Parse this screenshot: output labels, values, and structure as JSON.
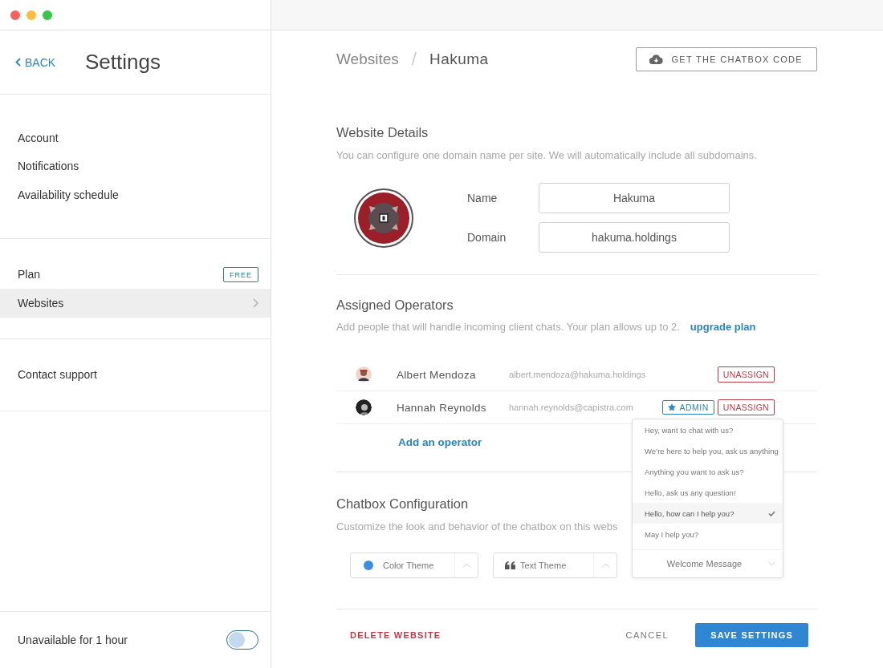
{
  "window": {
    "traffic_lights": [
      {
        "color": "#fc605c"
      },
      {
        "color": "#fdbc40"
      },
      {
        "color": "#34c84a"
      }
    ]
  },
  "sidebar": {
    "back": "BACK",
    "title": "Settings",
    "groups": [
      [
        {
          "label": "Account",
          "selected": false
        },
        {
          "label": "Notifications",
          "selected": false
        },
        {
          "label": "Availability schedule",
          "selected": false
        }
      ],
      [
        {
          "label": "Plan",
          "badge": "FREE",
          "selected": false
        },
        {
          "label": "Websites",
          "selected": true
        }
      ],
      [
        {
          "label": "Contact support",
          "selected": false
        }
      ]
    ],
    "availability": {
      "label": "Unavailable for 1 hour",
      "on": false
    }
  },
  "breadcrumb": [
    "Websites",
    "Hakuma"
  ],
  "breadcrumb_separator": "/",
  "chatbox_code_button": "GET THE CHATBOX CODE",
  "website_details": {
    "title": "Website Details",
    "description": "You can configure one domain name per site. We will automatically include all subdomains.",
    "fields": [
      {
        "label": "Name",
        "value": "Hakuma"
      },
      {
        "label": "Domain",
        "value": "hakuma.holdings"
      }
    ]
  },
  "assigned_operators": {
    "title": "Assigned Operators",
    "description": "Add people that will handle incoming client chats. Your plan allows up to 2.",
    "upgrade_link": "upgrade plan",
    "rows": [
      {
        "name": "Albert Mendoza",
        "email": "albert.mendoza@hakuma.holdings",
        "unassign": "UNASSIGN"
      },
      {
        "name": "Hannah Reynolds",
        "email": "hannah.reynolds@capistra.com",
        "badge": "ADMIN",
        "unassign": "UNASSIGN"
      }
    ],
    "add_link": "Add an operator"
  },
  "chatbox_configuration": {
    "title": "Chatbox Configuration",
    "description": "Customize the look and behavior of the chatbox on this webs",
    "selects": [
      {
        "kind": "color",
        "label": "Color Theme",
        "color": "#3d8ee2",
        "expanded": false
      },
      {
        "kind": "quote",
        "label": "Text Theme",
        "expanded": false
      },
      {
        "kind": "plain",
        "label": "Welcome Message",
        "expanded": true,
        "options": [
          {
            "label": "Hey, want to chat with us?",
            "selected": false
          },
          {
            "label": "We’re here to help you, ask us anything",
            "selected": false
          },
          {
            "label": "Anything you want to ask us?",
            "selected": false
          },
          {
            "label": "Hello, ask us any question!",
            "selected": false
          },
          {
            "label": "Hello, how can I help you?",
            "selected": true
          },
          {
            "label": "May I help you?",
            "selected": false
          }
        ]
      }
    ]
  },
  "footer": {
    "delete": "DELETE WEBSITE",
    "cancel": "CANCEL",
    "save": "SAVE SETTINGS"
  }
}
